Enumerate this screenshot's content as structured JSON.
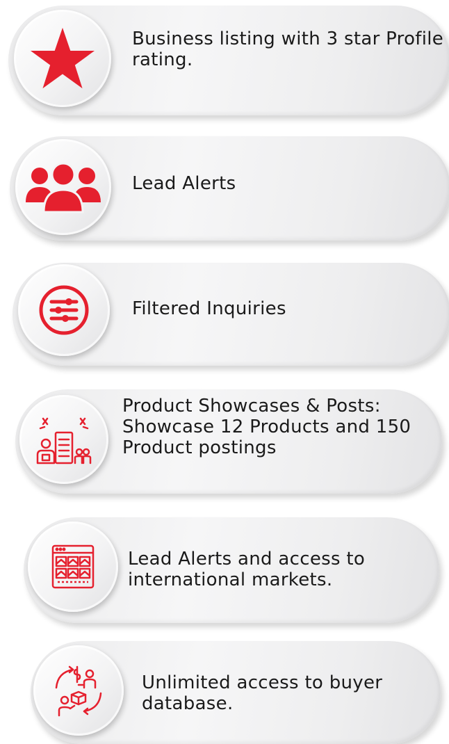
{
  "items": [
    {
      "label": "Business listing with 3 star Profile rating.",
      "icon": "star-icon"
    },
    {
      "label": "Lead Alerts",
      "icon": "users-group-icon"
    },
    {
      "label": "Filtered Inquiries",
      "icon": "filter-sliders-icon"
    },
    {
      "label": "Product Showcases & Posts: Showcase 12 Products and 150 Product postings",
      "icon": "product-showcase-icon"
    },
    {
      "label": "Lead Alerts and access to international markets.",
      "icon": "web-grid-icon"
    },
    {
      "label": "Unlimited access to buyer database.",
      "icon": "buyer-exchange-icon"
    }
  ],
  "colors": {
    "accent": "#e5202e",
    "text": "#1a1a1a"
  }
}
